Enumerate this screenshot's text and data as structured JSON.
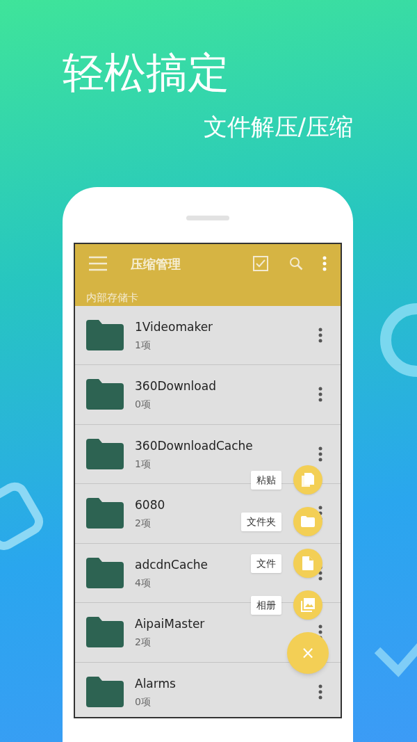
{
  "headline": "轻松搞定",
  "subtitle": "文件解压/压缩",
  "toolbar": {
    "title": "压缩管理",
    "path": "内部存储卡"
  },
  "folders": [
    {
      "name": "1Videomaker",
      "count": "1项"
    },
    {
      "name": "360Download",
      "count": "0项"
    },
    {
      "name": "360DownloadCache",
      "count": "1项"
    },
    {
      "name": "6080",
      "count": "2项"
    },
    {
      "name": "adcdnCache",
      "count": "4项"
    },
    {
      "name": "AipaiMaster",
      "count": "2项"
    },
    {
      "name": "Alarms",
      "count": "0项"
    }
  ],
  "fab_menu": [
    {
      "kind": "paste",
      "label": "粘贴"
    },
    {
      "kind": "folder",
      "label": "文件夹"
    },
    {
      "kind": "file",
      "label": "文件"
    },
    {
      "kind": "album",
      "label": "相册"
    }
  ],
  "fab_close": "×"
}
